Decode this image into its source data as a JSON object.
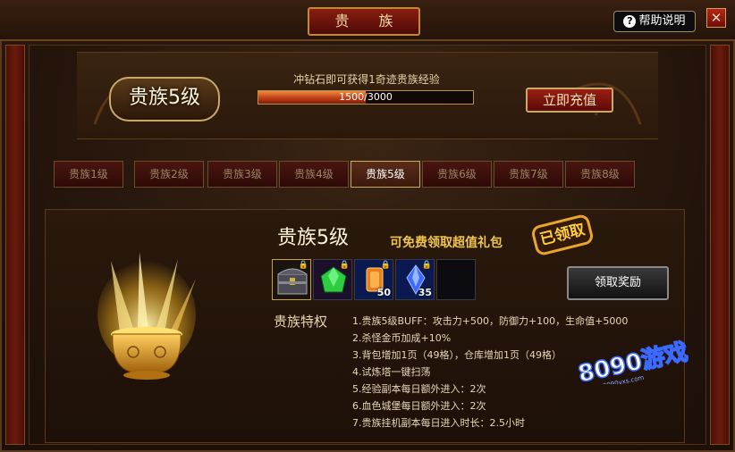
{
  "window": {
    "title": "贵 族",
    "help_label": "帮助说明",
    "close_label": "✕"
  },
  "header": {
    "rank_badge": "贵族5级",
    "progress_caption": "冲钻石即可获得1奇迹贵族经验",
    "progress_text": "1500/3000",
    "progress_current": 1500,
    "progress_max": 3000,
    "recharge_label": "立即充值"
  },
  "tabs": [
    "贵族1级",
    "贵族2级",
    "贵族3级",
    "贵族4级",
    "贵族5级",
    "贵族6级",
    "贵族7级",
    "贵族8级"
  ],
  "active_tab_index": 4,
  "reward": {
    "level_title": "贵族5级",
    "gift_text": "可免费领取超值礼包",
    "stamp": "已领取",
    "claim_label": "领取奖励",
    "items": [
      {
        "icon": "treasure-chest-icon",
        "count": ""
      },
      {
        "icon": "green-gem-icon",
        "count": ""
      },
      {
        "icon": "orange-gem-icon",
        "count": "50"
      },
      {
        "icon": "blue-crystal-icon",
        "count": "35"
      },
      {
        "icon": "empty-slot",
        "count": ""
      }
    ]
  },
  "privileges": {
    "label": "贵族特权",
    "items": [
      "1.贵族5级BUFF：攻击力+500，防御力+100，生命值+5000",
      "2.杀怪金币加成+10%",
      "3.背包增加1页（49格），仓库增加1页（49格）",
      "4.试炼塔一键扫荡",
      "5.经验副本每日额外进入：2次",
      "6.血色城堡每日额外进入：2次",
      "7.贵族挂机副本每日进入时长：2.5小时"
    ]
  },
  "watermark": {
    "text": "8090游戏",
    "sub": "8090yxs.com"
  },
  "colors": {
    "accent_gold": "#c9a86a",
    "button_red": "#9a1e12",
    "progress_fill": "#c0401a",
    "gift_yellow": "#f0c54a"
  }
}
